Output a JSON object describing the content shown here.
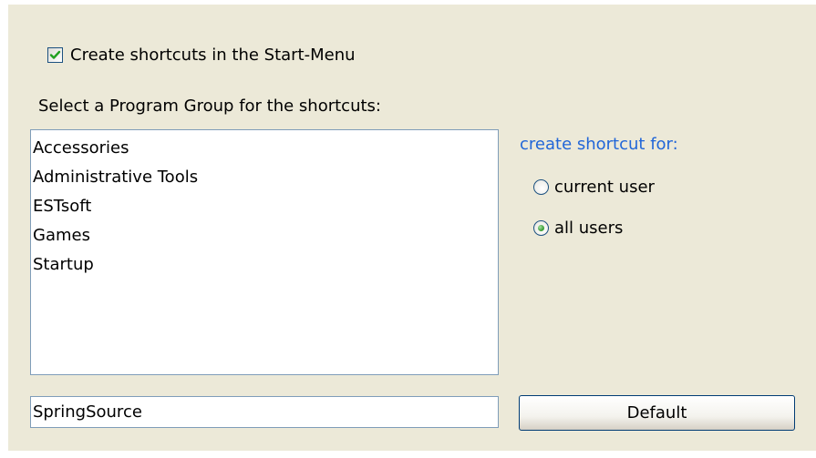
{
  "startmenu": {
    "checkbox_label": "Create shortcuts in the Start-Menu",
    "checked": true
  },
  "program_group": {
    "label": "Select a Program Group for the shortcuts:",
    "items": [
      "Accessories",
      "Administrative Tools",
      "ESTsoft",
      "Games",
      "Startup"
    ],
    "folder_name": "SpringSource"
  },
  "shortcut_for": {
    "label": "create shortcut for:",
    "options": [
      {
        "label": "current user",
        "selected": false
      },
      {
        "label": "all users",
        "selected": true
      }
    ]
  },
  "buttons": {
    "default_label": "Default"
  },
  "colors": {
    "panel_bg": "#ece9d8",
    "accent_blue": "#2166d8",
    "field_border": "#7f9db9",
    "check_green": "#21a121"
  }
}
